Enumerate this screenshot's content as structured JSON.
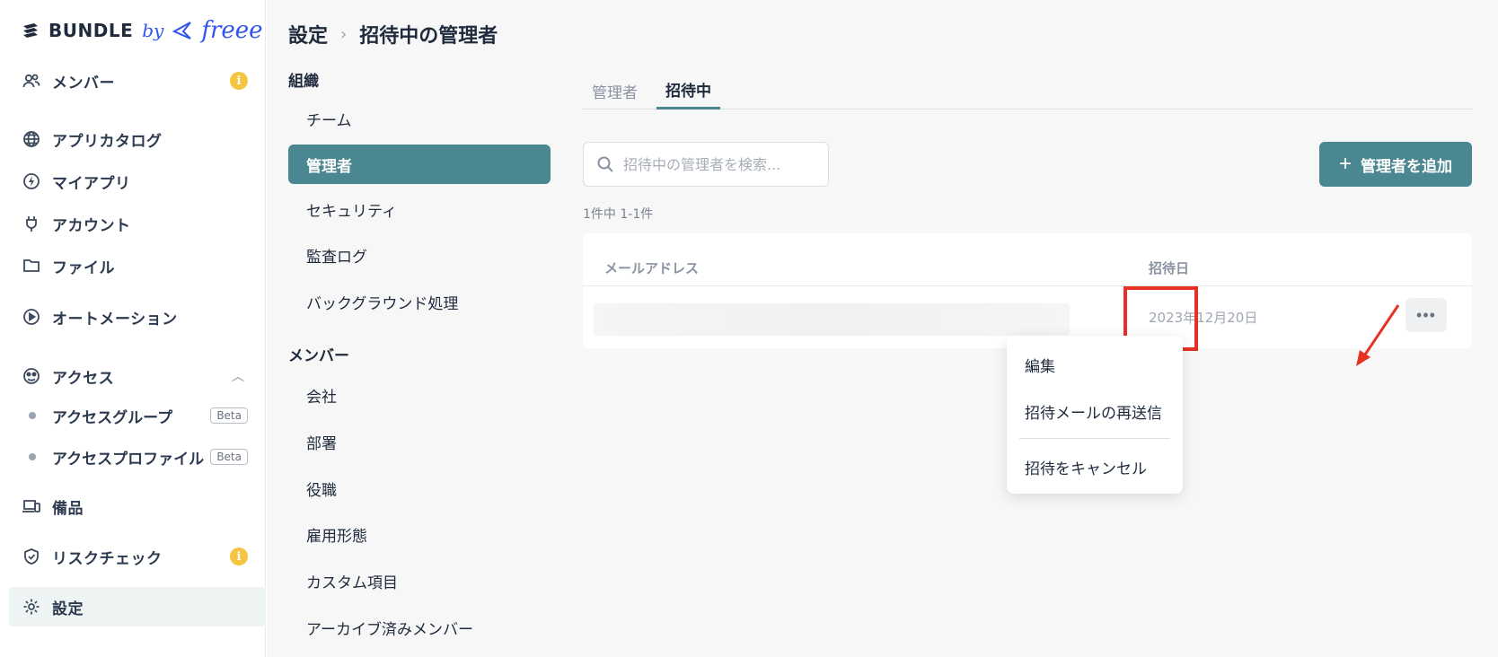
{
  "brand": {
    "name": "BUNDLE",
    "by": "by",
    "partner": "freee"
  },
  "sidebar": {
    "items": [
      {
        "label": "メンバー",
        "icon": "users-icon",
        "badge": "i"
      },
      {
        "label": "アプリカタログ",
        "icon": "globe-icon"
      },
      {
        "label": "マイアプリ",
        "icon": "bolt-icon"
      },
      {
        "label": "アカウント",
        "icon": "plug-icon"
      },
      {
        "label": "ファイル",
        "icon": "folder-icon"
      },
      {
        "label": "オートメーション",
        "icon": "play-icon"
      },
      {
        "label": "アクセス",
        "icon": "access-icon"
      },
      {
        "label": "アクセスグループ",
        "beta": "Beta"
      },
      {
        "label": "アクセスプロファイル",
        "beta": "Beta"
      },
      {
        "label": "備品",
        "icon": "devices-icon"
      },
      {
        "label": "リスクチェック",
        "icon": "shield-icon",
        "badge": "i"
      },
      {
        "label": "設定",
        "icon": "gear-icon"
      }
    ]
  },
  "breadcrumb": {
    "parent": "設定",
    "current": "招待中の管理者"
  },
  "settings_nav": {
    "org_heading": "組織",
    "org_items": [
      "チーム",
      "管理者",
      "セキュリティ",
      "監査ログ",
      "バックグラウンド処理"
    ],
    "member_heading": "メンバー",
    "member_items": [
      "会社",
      "部署",
      "役職",
      "雇用形態",
      "カスタム項目",
      "アーカイブ済みメンバー"
    ]
  },
  "tabs": {
    "admins": "管理者",
    "invited": "招待中"
  },
  "search": {
    "placeholder": "招待中の管理者を検索..."
  },
  "add_button": {
    "label": "管理者を追加"
  },
  "result_count": "1件中 1-1件",
  "table": {
    "columns": {
      "email": "メールアドレス",
      "invited_date": "招待日"
    },
    "rows": [
      {
        "invited_date": "2023年12月20日"
      }
    ]
  },
  "menu": {
    "edit": "編集",
    "resend": "招待メールの再送信",
    "cancel": "招待をキャンセル"
  },
  "colors": {
    "accent": "#4a8790",
    "highlight": "#e53224",
    "badge": "#f5c542"
  }
}
